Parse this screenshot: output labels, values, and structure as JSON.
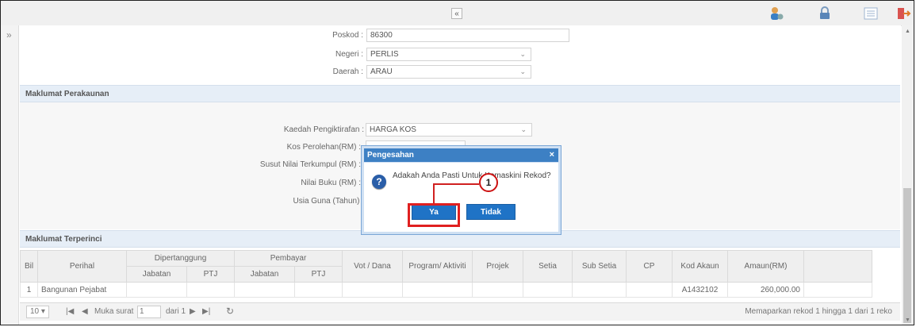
{
  "toolbar": {
    "collapse_glyph": "«",
    "icons": [
      "user-settings-icon",
      "lock-icon",
      "list-view-icon",
      "logout-icon"
    ]
  },
  "sidebar_toggle": "»",
  "address": {
    "poskod_label": "Poskod :",
    "poskod_value": "86300",
    "negeri_label": "Negeri :",
    "negeri_value": "PERLIS",
    "daerah_label": "Daerah :",
    "daerah_value": "ARAU"
  },
  "perakaunan": {
    "title": "Maklumat Perakaunan",
    "kaedah_label": "Kaedah Pengiktirafan :",
    "kaedah_value": "HARGA KOS",
    "kos_label": "Kos Perolehan(RM) :",
    "susut_label": "Susut Nilai Terkumpul (RM) :",
    "nilai_label": "Nilai Buku (RM) :",
    "usia_label": "Usia Guna (Tahun) :"
  },
  "terperinci": {
    "title": "Maklumat Terperinci",
    "headers": {
      "bil": "Bil",
      "perihal": "Perihal",
      "dipertanggung": "Dipertanggung",
      "pembayar": "Pembayar",
      "jabatan": "Jabatan",
      "ptj": "PTJ",
      "vot": "Vot / Dana",
      "program": "Program/ Aktiviti",
      "projek": "Projek",
      "setia": "Setia",
      "subsetia": "Sub Setia",
      "cp": "CP",
      "kodakaun": "Kod Akaun",
      "amaun": "Amaun(RM)"
    },
    "rows": [
      {
        "bil": "1",
        "perihal": "Bangunan Pejabat",
        "kodakaun": "A1432102",
        "amaun": "260,000.00"
      }
    ]
  },
  "pager": {
    "page_size": "10",
    "muka_surat_label": "Muka surat",
    "page": "1",
    "dari_label": "dari 1",
    "summary": "Memaparkan rekod 1 hingga 1 dari 1 reko"
  },
  "dialog": {
    "title": "Pengesahan",
    "close": "×",
    "message": "Adakah Anda Pasti Untuk Kemaskini Rekod?",
    "yes_label": "Ya",
    "no_label": "Tidak"
  },
  "callout": {
    "number": "1"
  }
}
